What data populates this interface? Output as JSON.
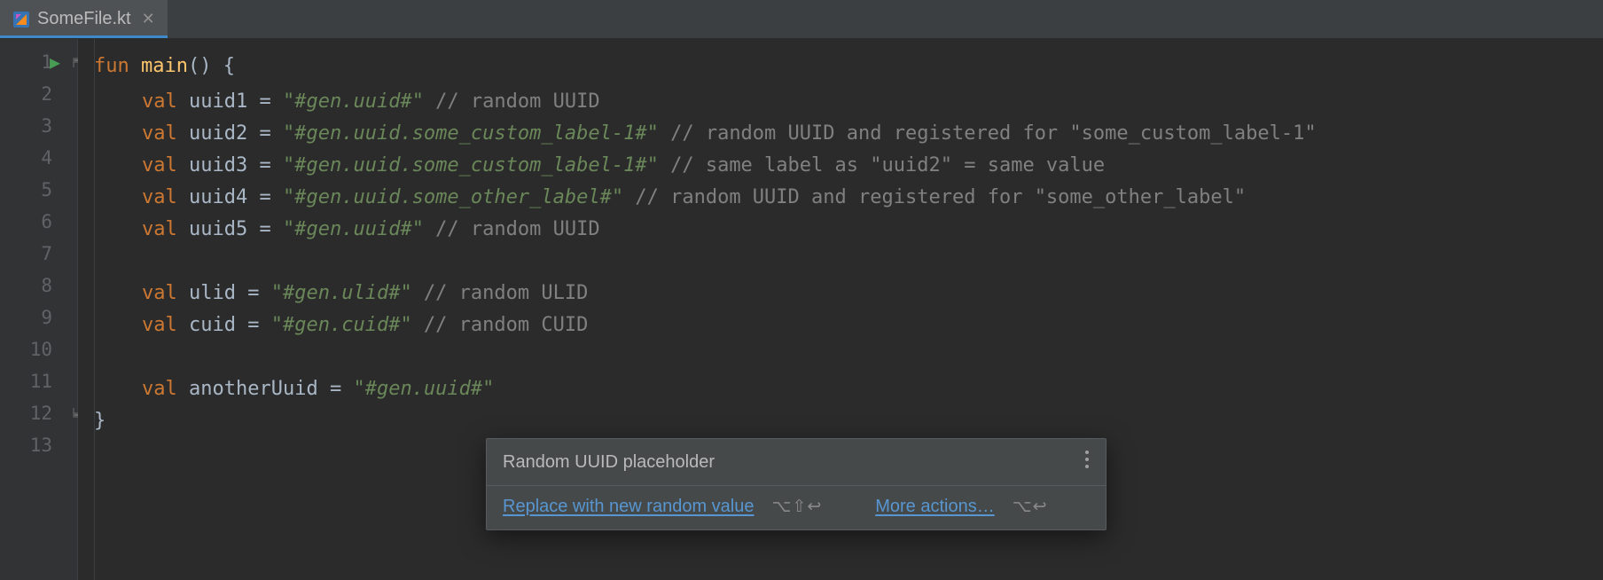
{
  "tab": {
    "filename": "SomeFile.kt"
  },
  "gutter": {
    "lines": [
      "1",
      "2",
      "3",
      "4",
      "5",
      "6",
      "7",
      "8",
      "9",
      "10",
      "11",
      "12",
      "13"
    ]
  },
  "code": {
    "l1": {
      "kw": "fun",
      "fn": "main",
      "paren": "() {"
    },
    "l2": {
      "kw": "val",
      "id": "uuid1",
      "eq": " = ",
      "q1": "\"",
      "s": "#gen.uuid#",
      "q2": "\"",
      "cm": " // random UUID"
    },
    "l3": {
      "kw": "val",
      "id": "uuid2",
      "eq": " = ",
      "q1": "\"",
      "s": "#gen.uuid.some_custom_label-1#",
      "q2": "\"",
      "cm": " // random UUID and registered for \"some_custom_label-1\""
    },
    "l4": {
      "kw": "val",
      "id": "uuid3",
      "eq": " = ",
      "q1": "\"",
      "s": "#gen.uuid.some_custom_label-1#",
      "q2": "\"",
      "cm": " // same label as \"uuid2\" = same value"
    },
    "l5": {
      "kw": "val",
      "id": "uuid4",
      "eq": " = ",
      "q1": "\"",
      "s": "#gen.uuid.some_other_label#",
      "q2": "\"",
      "cm": " // random UUID and registered for \"some_other_label\""
    },
    "l6": {
      "kw": "val",
      "id": "uuid5",
      "eq": " = ",
      "q1": "\"",
      "s": "#gen.uuid#",
      "q2": "\"",
      "cm": " // random UUID"
    },
    "l8": {
      "kw": "val",
      "id": "ulid",
      "eq": " = ",
      "q1": "\"",
      "s": "#gen.ulid#",
      "q2": "\"",
      "cm": " // random ULID"
    },
    "l9": {
      "kw": "val",
      "id": "cuid",
      "eq": " = ",
      "q1": "\"",
      "s": "#gen.cuid#",
      "q2": "\"",
      "cm": " // random CUID"
    },
    "l11": {
      "kw": "val",
      "id": "anotherUuid",
      "eq": " = ",
      "q1": "\"",
      "s": "#gen.uuid#",
      "q2": "\""
    },
    "l12": {
      "brace": "}"
    }
  },
  "popup": {
    "title": "Random UUID placeholder",
    "action1": "Replace with new random value",
    "shortcut1": "⌥⇧↩",
    "action2": "More actions…",
    "shortcut2": "⌥↩"
  }
}
